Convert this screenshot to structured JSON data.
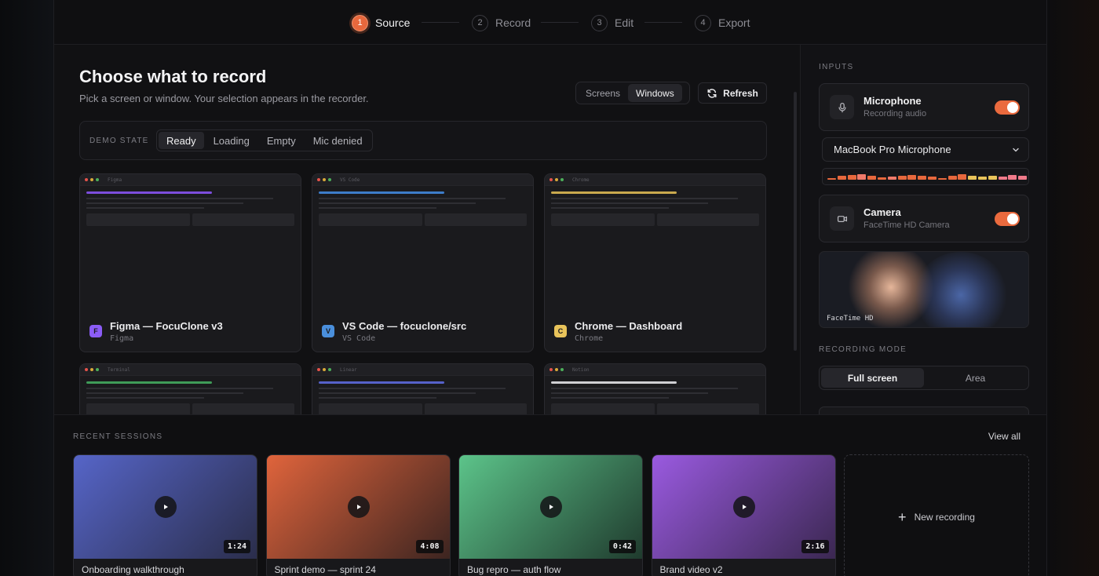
{
  "stepper": {
    "steps": [
      {
        "num": "1",
        "label": "Source"
      },
      {
        "num": "2",
        "label": "Record"
      },
      {
        "num": "3",
        "label": "Edit"
      },
      {
        "num": "4",
        "label": "Export"
      }
    ],
    "active_index": 0
  },
  "main": {
    "title": "Choose what to record",
    "subtitle": "Pick a screen or window. Your selection appears in the recorder.",
    "view_toggle": {
      "options": [
        "Screens",
        "Windows"
      ],
      "selected": "Windows"
    },
    "refresh_label": "Refresh",
    "demo_state": {
      "label": "DEMO STATE",
      "options": [
        "Ready",
        "Loading",
        "Empty",
        "Mic denied"
      ],
      "selected": "Ready"
    },
    "windows": [
      {
        "bar_name": "Figma",
        "title": "Figma — FocuClone v3",
        "app": "Figma",
        "badge": "F",
        "badge_color": "#8b5cf6",
        "accent": "#7c4ddc"
      },
      {
        "bar_name": "VS Code",
        "title": "VS Code — focuclone/src",
        "app": "VS Code",
        "badge": "V",
        "badge_color": "#4a8fdc",
        "accent": "#3d7cc9"
      },
      {
        "bar_name": "Chrome",
        "title": "Chrome — Dashboard",
        "app": "Chrome",
        "badge": "C",
        "badge_color": "#e8c35a",
        "accent": "#c9a94e"
      },
      {
        "bar_name": "Terminal",
        "title": "",
        "app": "",
        "badge": "",
        "badge_color": "#3f9b58",
        "accent": "#3f9b58"
      },
      {
        "bar_name": "Linear",
        "title": "",
        "app": "",
        "badge": "",
        "badge_color": "#5661c9",
        "accent": "#5661c9"
      },
      {
        "bar_name": "Notion",
        "title": "",
        "app": "",
        "badge": "",
        "badge_color": "#cfcfd3",
        "accent": "#cfcfd3"
      }
    ]
  },
  "panel": {
    "inputs_label": "INPUTS",
    "microphone": {
      "name": "Microphone",
      "status": "Recording audio",
      "enabled": true
    },
    "mic_device": "MacBook Pro Microphone",
    "meter_levels": [
      0.15,
      0.55,
      0.7,
      0.75,
      0.55,
      0.35,
      0.45,
      0.6,
      0.7,
      0.55,
      0.45,
      0.2,
      0.55,
      0.75,
      0.6,
      0.4,
      0.5,
      0.45,
      0.7,
      0.6
    ],
    "camera": {
      "name": "Camera",
      "status": "FaceTime HD Camera",
      "enabled": true
    },
    "preview_caption": "FaceTime HD",
    "mode_label": "RECORDING MODE",
    "modes": [
      "Full screen",
      "Area"
    ],
    "mode_selected": "Full screen"
  },
  "recent": {
    "title": "RECENT SESSIONS",
    "view_all": "View all",
    "sessions": [
      {
        "name": "Onboarding walkthrough",
        "duration": "1:24",
        "grad": [
          "#5665c8",
          "#2a2d4a"
        ]
      },
      {
        "name": "Sprint demo — sprint 24",
        "duration": "4:08",
        "grad": [
          "#e0643c",
          "#3b2420"
        ]
      },
      {
        "name": "Bug repro — auth flow",
        "duration": "0:42",
        "grad": [
          "#5cc48a",
          "#1f3a2d"
        ]
      },
      {
        "name": "Brand video v2",
        "duration": "2:16",
        "grad": [
          "#9a5ae0",
          "#3a2750"
        ]
      }
    ],
    "new_recording": "New recording"
  },
  "colors": {
    "accent": "#e8683d",
    "bg": "#111113"
  }
}
